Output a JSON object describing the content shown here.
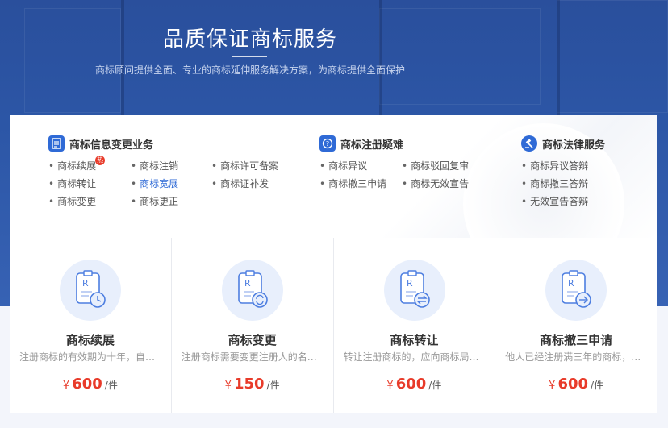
{
  "hero": {
    "title": "品质保证商标服务",
    "subtitle": "商标顾问提供全面、专业的商标延伸服务解决方案，为商标提供全面保护"
  },
  "groups": [
    {
      "title": "商标信息变更业务",
      "icon": "document-icon",
      "items": [
        {
          "label": "商标续展",
          "hot": true,
          "badge": "热"
        },
        {
          "label": "商标注销"
        },
        {
          "label": "商标许可备案"
        },
        {
          "label": "商标转让"
        },
        {
          "label": "商标宽展",
          "active": true
        },
        {
          "label": "商标证补发"
        },
        {
          "label": "商标变更"
        },
        {
          "label": "商标更正"
        }
      ]
    },
    {
      "title": "商标注册疑难",
      "icon": "question-icon",
      "items": [
        {
          "label": "商标异议"
        },
        {
          "label": "商标驳回复审"
        },
        {
          "label": "商标撤三申请"
        },
        {
          "label": "商标无效宣告"
        }
      ]
    },
    {
      "title": "商标法律服务",
      "icon": "gavel-icon",
      "items": [
        {
          "label": "商标异议答辩"
        },
        {
          "label": "商标撤三答辩"
        },
        {
          "label": "无效宣告答辩"
        }
      ]
    }
  ],
  "cards": [
    {
      "name": "商标续展",
      "desc": "注册商标的有效期为十年，自核准注册之日起计算",
      "currency": "¥",
      "price": "600",
      "unit": "/件",
      "icon": "renew-clock-icon"
    },
    {
      "name": "商标变更",
      "desc": "注册商标需要变更注册人的名义、地址或者其他注册事项的",
      "currency": "¥",
      "price": "150",
      "unit": "/件",
      "icon": "change-cycle-icon"
    },
    {
      "name": "商标转让",
      "desc": "转让注册商标的，应向商标局提交转让申请",
      "currency": "¥",
      "price": "600",
      "unit": "/件",
      "icon": "transfer-arrows-icon"
    },
    {
      "name": "商标撤三申请",
      "desc": "他人已经注册满三年的商标，长期不使用的可申请撤销",
      "currency": "¥",
      "price": "600",
      "unit": "/件",
      "icon": "cancel-arrow-icon"
    }
  ],
  "colors": {
    "accent": "#2f6ad6",
    "price": "#e83b2a",
    "hero": "#2c56a6"
  }
}
